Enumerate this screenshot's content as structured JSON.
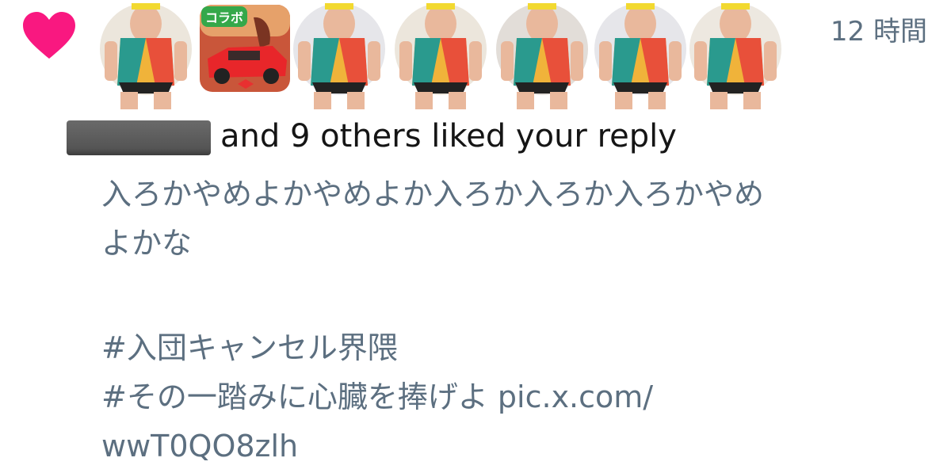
{
  "notification": {
    "timestamp": "12 時間",
    "liked_suffix": "and 9 others liked your reply",
    "reply_lines": [
      "入ろかやめよかやめよか入ろか入ろか入ろかやめ",
      "よかな",
      " #入団キャンセル界隈",
      " #その一踏みに心臓を捧げよ pic.x.com/",
      "wwT0QO8zlh"
    ],
    "avatar_badge": "コラボ",
    "colors": {
      "heart": "#f91880",
      "secondary_text": "#5c6f80",
      "primary_text": "#151515"
    }
  }
}
